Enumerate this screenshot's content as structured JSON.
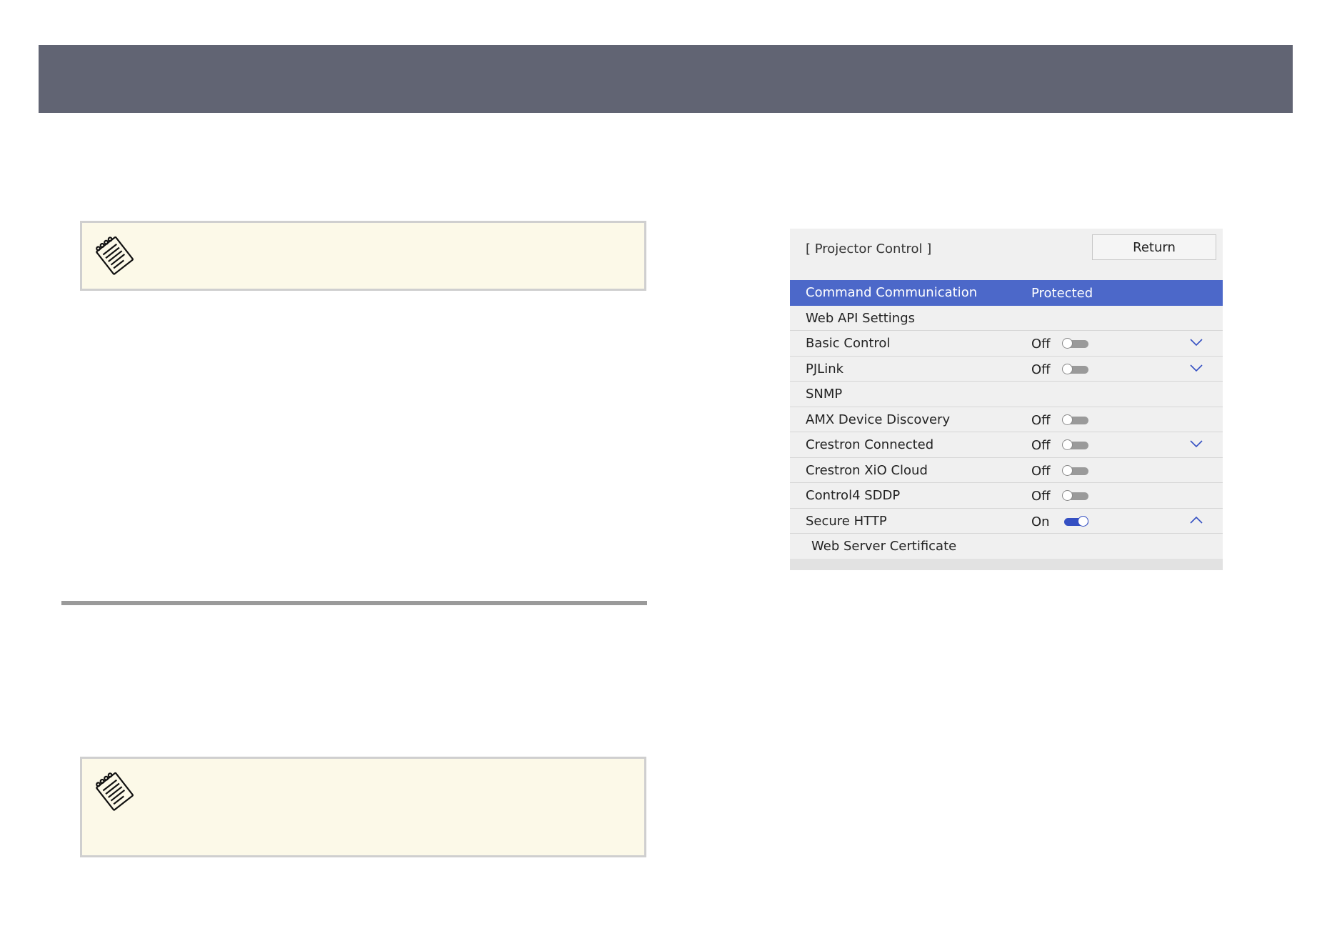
{
  "panel": {
    "title": "[ Projector Control ]",
    "return_label": "Return",
    "rows": [
      {
        "label": "Command Communication",
        "value": "Protected"
      },
      {
        "label": "Web API Settings"
      },
      {
        "label": "Basic Control",
        "value": "Off"
      },
      {
        "label": "PJLink",
        "value": "Off"
      },
      {
        "label": "SNMP"
      },
      {
        "label": "AMX Device Discovery",
        "value": "Off"
      },
      {
        "label": "Crestron Connected",
        "value": "Off"
      },
      {
        "label": "Crestron XiO Cloud",
        "value": "Off"
      },
      {
        "label": "Control4 SDDP",
        "value": "Off"
      },
      {
        "label": "Secure HTTP",
        "value": "On"
      },
      {
        "label": "Web Server Certificate"
      }
    ]
  },
  "icons": {
    "note": "notepad-icon",
    "collapsed": "chevron-down-icon",
    "expanded": "chevron-up-icon"
  },
  "colors": {
    "header_bar": "#616473",
    "note_bg": "#fcf9e8",
    "selected_row": "#4c68c9",
    "toggle_on": "#3550c3"
  }
}
